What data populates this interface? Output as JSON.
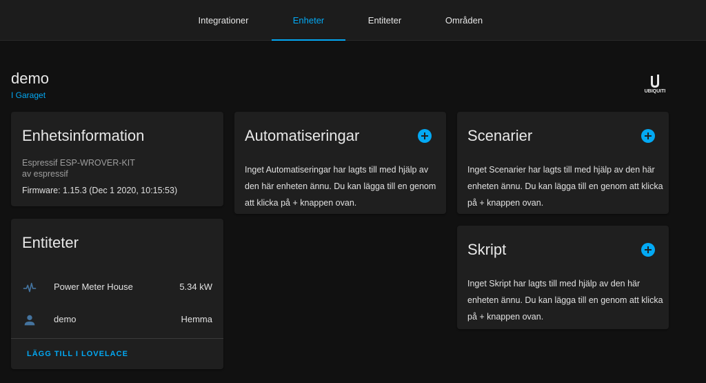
{
  "tabs": [
    {
      "label": "Integrationer"
    },
    {
      "label": "Enheter"
    },
    {
      "label": "Entiteter"
    },
    {
      "label": "Områden"
    }
  ],
  "device": {
    "name": "demo",
    "area": "I Garaget",
    "logo_text": "UBIQUITI"
  },
  "device_info": {
    "title": "Enhetsinformation",
    "model": "Espressif ESP-WROVER-KIT",
    "manufacturer": "av espressif",
    "firmware": "Firmware: 1.15.3 (Dec 1 2020, 10:15:53)"
  },
  "entities_card": {
    "title": "Entiteter",
    "rows": [
      {
        "icon": "pulse-icon",
        "name": "Power Meter House",
        "state": "5.34 kW"
      },
      {
        "icon": "person-icon",
        "name": "demo",
        "state": "Hemma"
      }
    ],
    "action": "LÄGG TILL I LOVELACE"
  },
  "automations": {
    "title": "Automatiseringar",
    "text": "Inget Automatiseringar har lagts till med hjälp av den här enheten ännu. Du kan lägga till en genom att klicka på + knappen ovan."
  },
  "scenes": {
    "title": "Scenarier",
    "text": "Inget Scenarier har lagts till med hjälp av den här enheten ännu. Du kan lägga till en genom att klicka på + knappen ovan."
  },
  "scripts": {
    "title": "Skript",
    "text": "Inget Skript har lagts till med hjälp av den här enheten ännu. Du kan lägga till en genom att klicka på + knappen ovan."
  },
  "colors": {
    "accent": "#03a9f4",
    "background": "#111111",
    "card": "#1f1f1f",
    "icon": "#44739e"
  }
}
